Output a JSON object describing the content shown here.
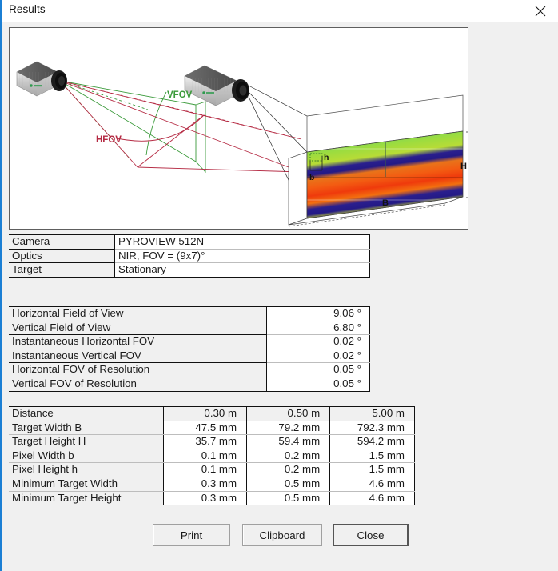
{
  "window": {
    "title": "Results",
    "close_icon": "close-icon",
    "accent_color": "#1b7fd4"
  },
  "diagram": {
    "labels": {
      "vfov": "VFOV",
      "hfov": "HFOV",
      "target_width": "B",
      "target_height": "H",
      "pixel_width": "b",
      "pixel_height": "h"
    },
    "colors": {
      "vfov": "#3a9a3a",
      "hfov": "#b52a43"
    }
  },
  "camera_table": {
    "rows": [
      {
        "label": "Camera",
        "value": "PYROVIEW 512N"
      },
      {
        "label": "Optics",
        "value": "NIR, FOV = (9x7)°"
      },
      {
        "label": "Target",
        "value": "Stationary"
      }
    ]
  },
  "fov_table": {
    "rows": [
      {
        "label": "Horizontal Field of View",
        "value": "9.06 °"
      },
      {
        "label": "Vertical Field of View",
        "value": "6.80 °"
      },
      {
        "label": "Instantaneous Horizontal FOV",
        "value": "0.02 °"
      },
      {
        "label": "Instantaneous Vertical FOV",
        "value": "0.02 °"
      },
      {
        "label": "Horizontal FOV of Resolution",
        "value": "0.05 °"
      },
      {
        "label": "Vertical FOV of Resolution",
        "value": "0.05 °"
      }
    ]
  },
  "distance_table": {
    "header": {
      "label": "Distance",
      "c1": "0.30 m",
      "c2": "0.50 m",
      "c3": "5.00 m"
    },
    "rows": [
      {
        "label": "Target Width B",
        "c1": "47.5 mm",
        "c2": "79.2 mm",
        "c3": "792.3 mm"
      },
      {
        "label": "Target Height H",
        "c1": "35.7 mm",
        "c2": "59.4 mm",
        "c3": "594.2 mm"
      },
      {
        "label": "Pixel Width b",
        "c1": "0.1 mm",
        "c2": "0.2 mm",
        "c3": "1.5 mm"
      },
      {
        "label": "Pixel Height h",
        "c1": "0.1 mm",
        "c2": "0.2 mm",
        "c3": "1.5 mm"
      },
      {
        "label": "Minimum Target Width",
        "c1": "0.3 mm",
        "c2": "0.5 mm",
        "c3": "4.6 mm"
      },
      {
        "label": "Minimum Target Height",
        "c1": "0.3 mm",
        "c2": "0.5 mm",
        "c3": "4.6 mm"
      }
    ]
  },
  "buttons": {
    "print": "Print",
    "clipboard": "Clipboard",
    "close": "Close"
  }
}
